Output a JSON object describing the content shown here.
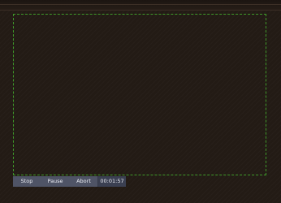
{
  "controls": {
    "stop_label": "Stop",
    "pause_label": "Pause",
    "abort_label": "Abort",
    "timer_value": "00:01:57"
  },
  "colors": {
    "background": "#231b15",
    "frame_border": "#3f9a2a",
    "control_bar": "#4f5466"
  }
}
